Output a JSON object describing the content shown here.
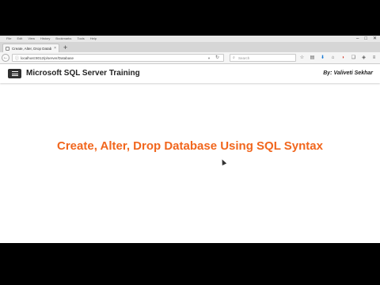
{
  "browser": {
    "menu": [
      "File",
      "Edit",
      "View",
      "History",
      "Bookmarks",
      "Tools",
      "Help"
    ],
    "window_controls": [
      "–",
      "□",
      "✕"
    ],
    "tab": {
      "title": "Create, Alter, Drop Database U",
      "close": "×"
    },
    "new_tab": "+",
    "back": "←",
    "url": "localhost:8012/p/server/Database",
    "search_placeholder": "Search",
    "toolbar_icons": [
      "star-icon",
      "library-icon",
      "download-icon",
      "home-icon",
      "pocket-icon",
      "bookmark-icon",
      "shield-icon",
      "menu-icon"
    ]
  },
  "app": {
    "title": "Microsoft SQL Server Training",
    "author": "By: Valiveti Sekhar"
  },
  "main": {
    "headline": "Create, Alter, Drop Database Using SQL Syntax"
  },
  "colors": {
    "headline": "#f1661d",
    "hamburger_bg": "#2f2f2f"
  }
}
